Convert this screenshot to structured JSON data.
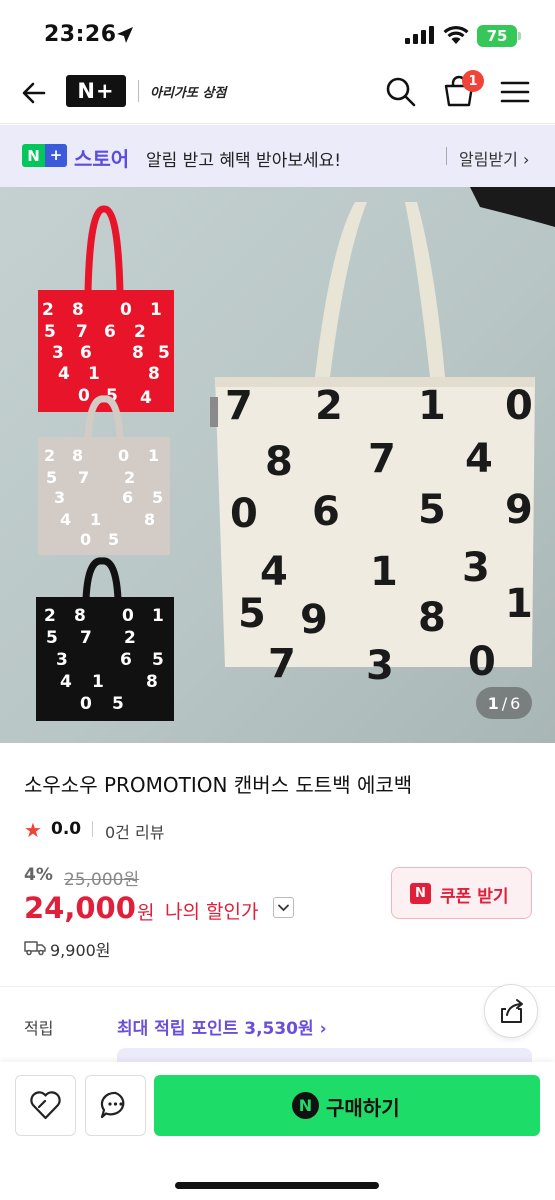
{
  "status_bar": {
    "time": "23:26",
    "battery": "75"
  },
  "nav": {
    "logo": "N+",
    "store_name": "아리가또 상점",
    "cart_count": "1"
  },
  "banner": {
    "brand_logo": "N+",
    "store_label": "스토어",
    "text": "알림 받고 혜택 받아보세요!",
    "alarm_label": "알림받기 ›"
  },
  "gallery": {
    "current": "1",
    "separator": "/",
    "total": "6"
  },
  "product": {
    "title": "소우소우 PROMOTION 캔버스 도트백 에코백",
    "rating": "0.0",
    "review_count": "0건 리뷰",
    "discount_rate": "4%",
    "original_price": "25,000원",
    "sale_price": "24,000",
    "currency": "원",
    "my_price_label": "나의 할인가",
    "coupon_icon": "N",
    "coupon_label": "쿠폰 받기",
    "shipping_fee": "9,900원",
    "points_label": "적립",
    "points_value": "최대 적립 포인트 3,530원 ›"
  },
  "bottom_bar": {
    "buy_icon": "N",
    "buy_label": "구매하기"
  },
  "colors": {
    "naver_green": "#03c75a",
    "buy_green": "#1edc68",
    "sale_red": "#e0203a",
    "store_purple": "#5b4de0",
    "banner_bg": "#ecebfa"
  },
  "icons": [
    "back-arrow-icon",
    "search-icon",
    "cart-icon",
    "menu-icon",
    "star-icon",
    "chevron-down-icon",
    "truck-icon",
    "share-icon",
    "heart-icon",
    "chat-icon"
  ]
}
